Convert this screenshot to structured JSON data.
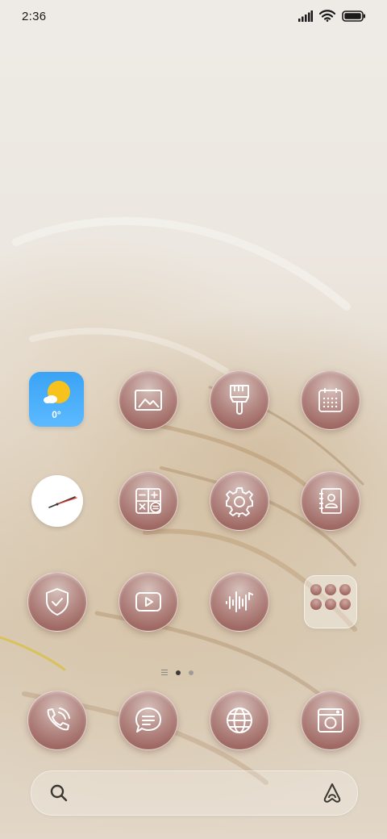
{
  "status_bar": {
    "time": "2:36",
    "icons": [
      "cellular-signal-icon",
      "wifi-icon",
      "battery-icon"
    ]
  },
  "home_screen": {
    "rows": [
      [
        {
          "name": "weather-widget",
          "icon": "sun-cloud-icon",
          "text": "0°"
        },
        {
          "name": "gallery-app",
          "icon": "image-icon"
        },
        {
          "name": "themes-app",
          "icon": "paintbrush-icon"
        },
        {
          "name": "calendar-app",
          "icon": "calendar-icon"
        }
      ],
      [
        {
          "name": "clock-app",
          "icon": "clock-icon"
        },
        {
          "name": "calculator-app",
          "icon": "calculator-icon"
        },
        {
          "name": "settings-app",
          "icon": "gear-icon"
        },
        {
          "name": "contacts-app",
          "icon": "contact-book-icon"
        }
      ],
      [
        {
          "name": "security-app",
          "icon": "shield-check-icon"
        },
        {
          "name": "video-app",
          "icon": "play-icon"
        },
        {
          "name": "music-app",
          "icon": "sound-wave-icon"
        },
        {
          "name": "app-folder",
          "icon": "folder-icon"
        }
      ]
    ],
    "page_indicator": {
      "pages": 2,
      "current": 1
    },
    "dock": [
      {
        "name": "phone-app",
        "icon": "phone-icon"
      },
      {
        "name": "messages-app",
        "icon": "chat-bubble-icon"
      },
      {
        "name": "browser-app",
        "icon": "globe-icon"
      },
      {
        "name": "camera-app",
        "icon": "camera-icon"
      }
    ],
    "search_bar": {
      "left_icon": "search-icon",
      "right_icon": "assistant-icon"
    }
  },
  "colors": {
    "app_icon_maroon": "#905049",
    "app_icon_light": "#d7c1bb",
    "weather_blue": "#3aa3f5",
    "sun_yellow": "#f7c21b"
  }
}
